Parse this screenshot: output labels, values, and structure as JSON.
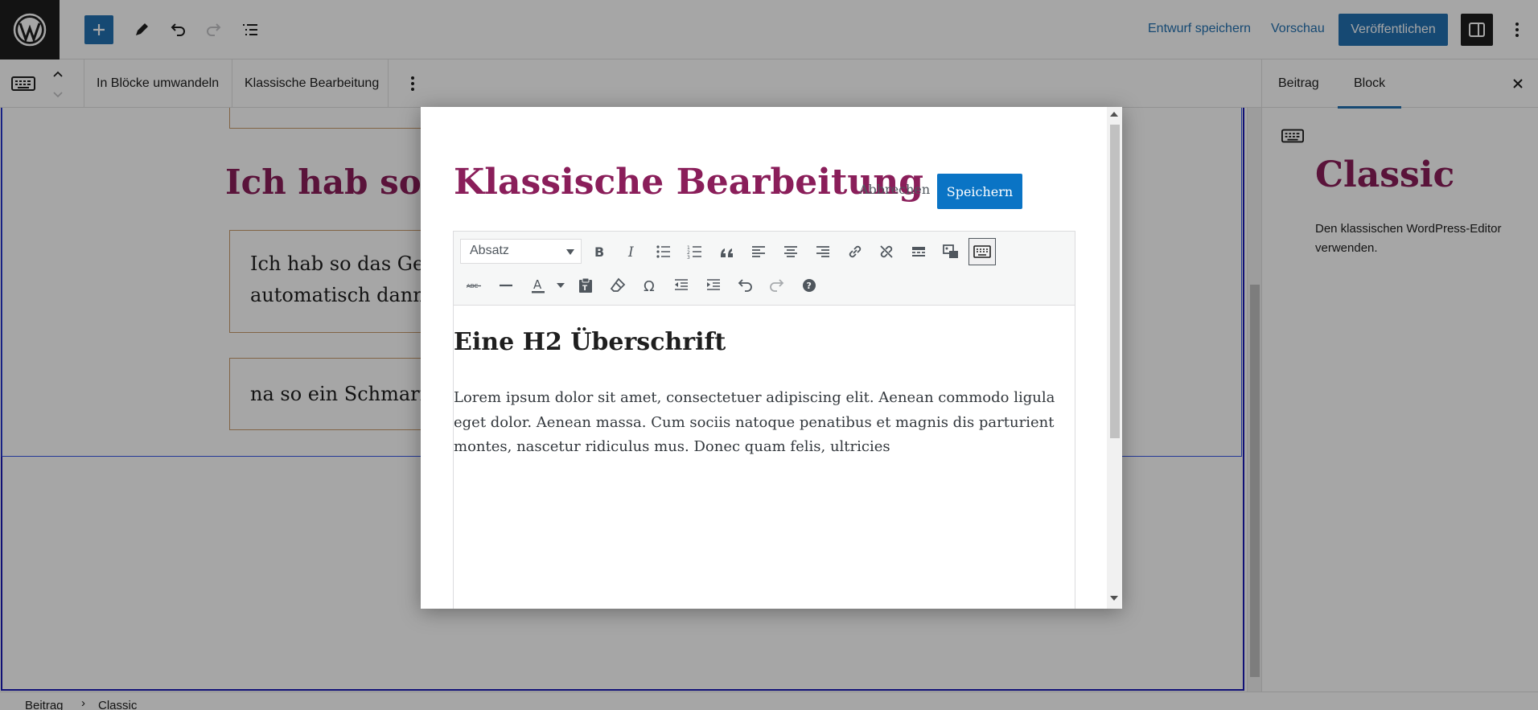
{
  "topbar": {
    "save_draft": "Entwurf speichern",
    "preview": "Vorschau",
    "publish": "Veröffentlichen"
  },
  "block_toolbar": {
    "convert": "In Blöcke umwandeln",
    "classic_edit": "Klassische Bearbeitung"
  },
  "canvas": {
    "heading": "Ich hab so d",
    "para1_line1": "Ich hab so das Ge",
    "para1_line2": "automatisch dann",
    "para2": "na so ein Schmarr"
  },
  "sidebar": {
    "tabs": [
      "Beitrag",
      "Block"
    ],
    "active_tab": "Block",
    "block_title": "Classic",
    "block_description": "Den klassischen WordPress-Editor verwenden."
  },
  "footer": {
    "breadcrumb": [
      "Beitrag",
      "Classic"
    ]
  },
  "modal": {
    "title": "Klassische Bearbeitung",
    "cancel": "Abbrechen",
    "save": "Speichern",
    "format_select": "Absatz",
    "content": {
      "heading": "Eine H2 Überschrift",
      "paragraph": "Lorem ipsum dolor sit amet, consectetuer adipiscing elit. Aenean commodo ligula eget dolor. Aenean massa. Cum sociis natoque penatibus et magnis dis parturient montes, nascetur ridiculus mus. Donec quam felis, ultricies"
    },
    "toolbar_row1_icons": [
      "bold-icon",
      "italic-icon",
      "bullet-list-icon",
      "numbered-list-icon",
      "blockquote-icon",
      "align-left-icon",
      "align-center-icon",
      "align-right-icon",
      "link-icon",
      "unlink-icon",
      "read-more-icon",
      "media-icon",
      "toolbar-toggle-icon"
    ],
    "toolbar_row2_icons": [
      "strikethrough-icon",
      "horizontal-line-icon",
      "text-color-icon",
      "paste-text-icon",
      "clear-formatting-icon",
      "special-character-icon",
      "outdent-icon",
      "indent-icon",
      "undo-icon",
      "redo-icon",
      "help-icon"
    ]
  },
  "colors": {
    "accent": "#2271b1",
    "title": "#8a1e5a",
    "save_button": "#0a74c5"
  }
}
